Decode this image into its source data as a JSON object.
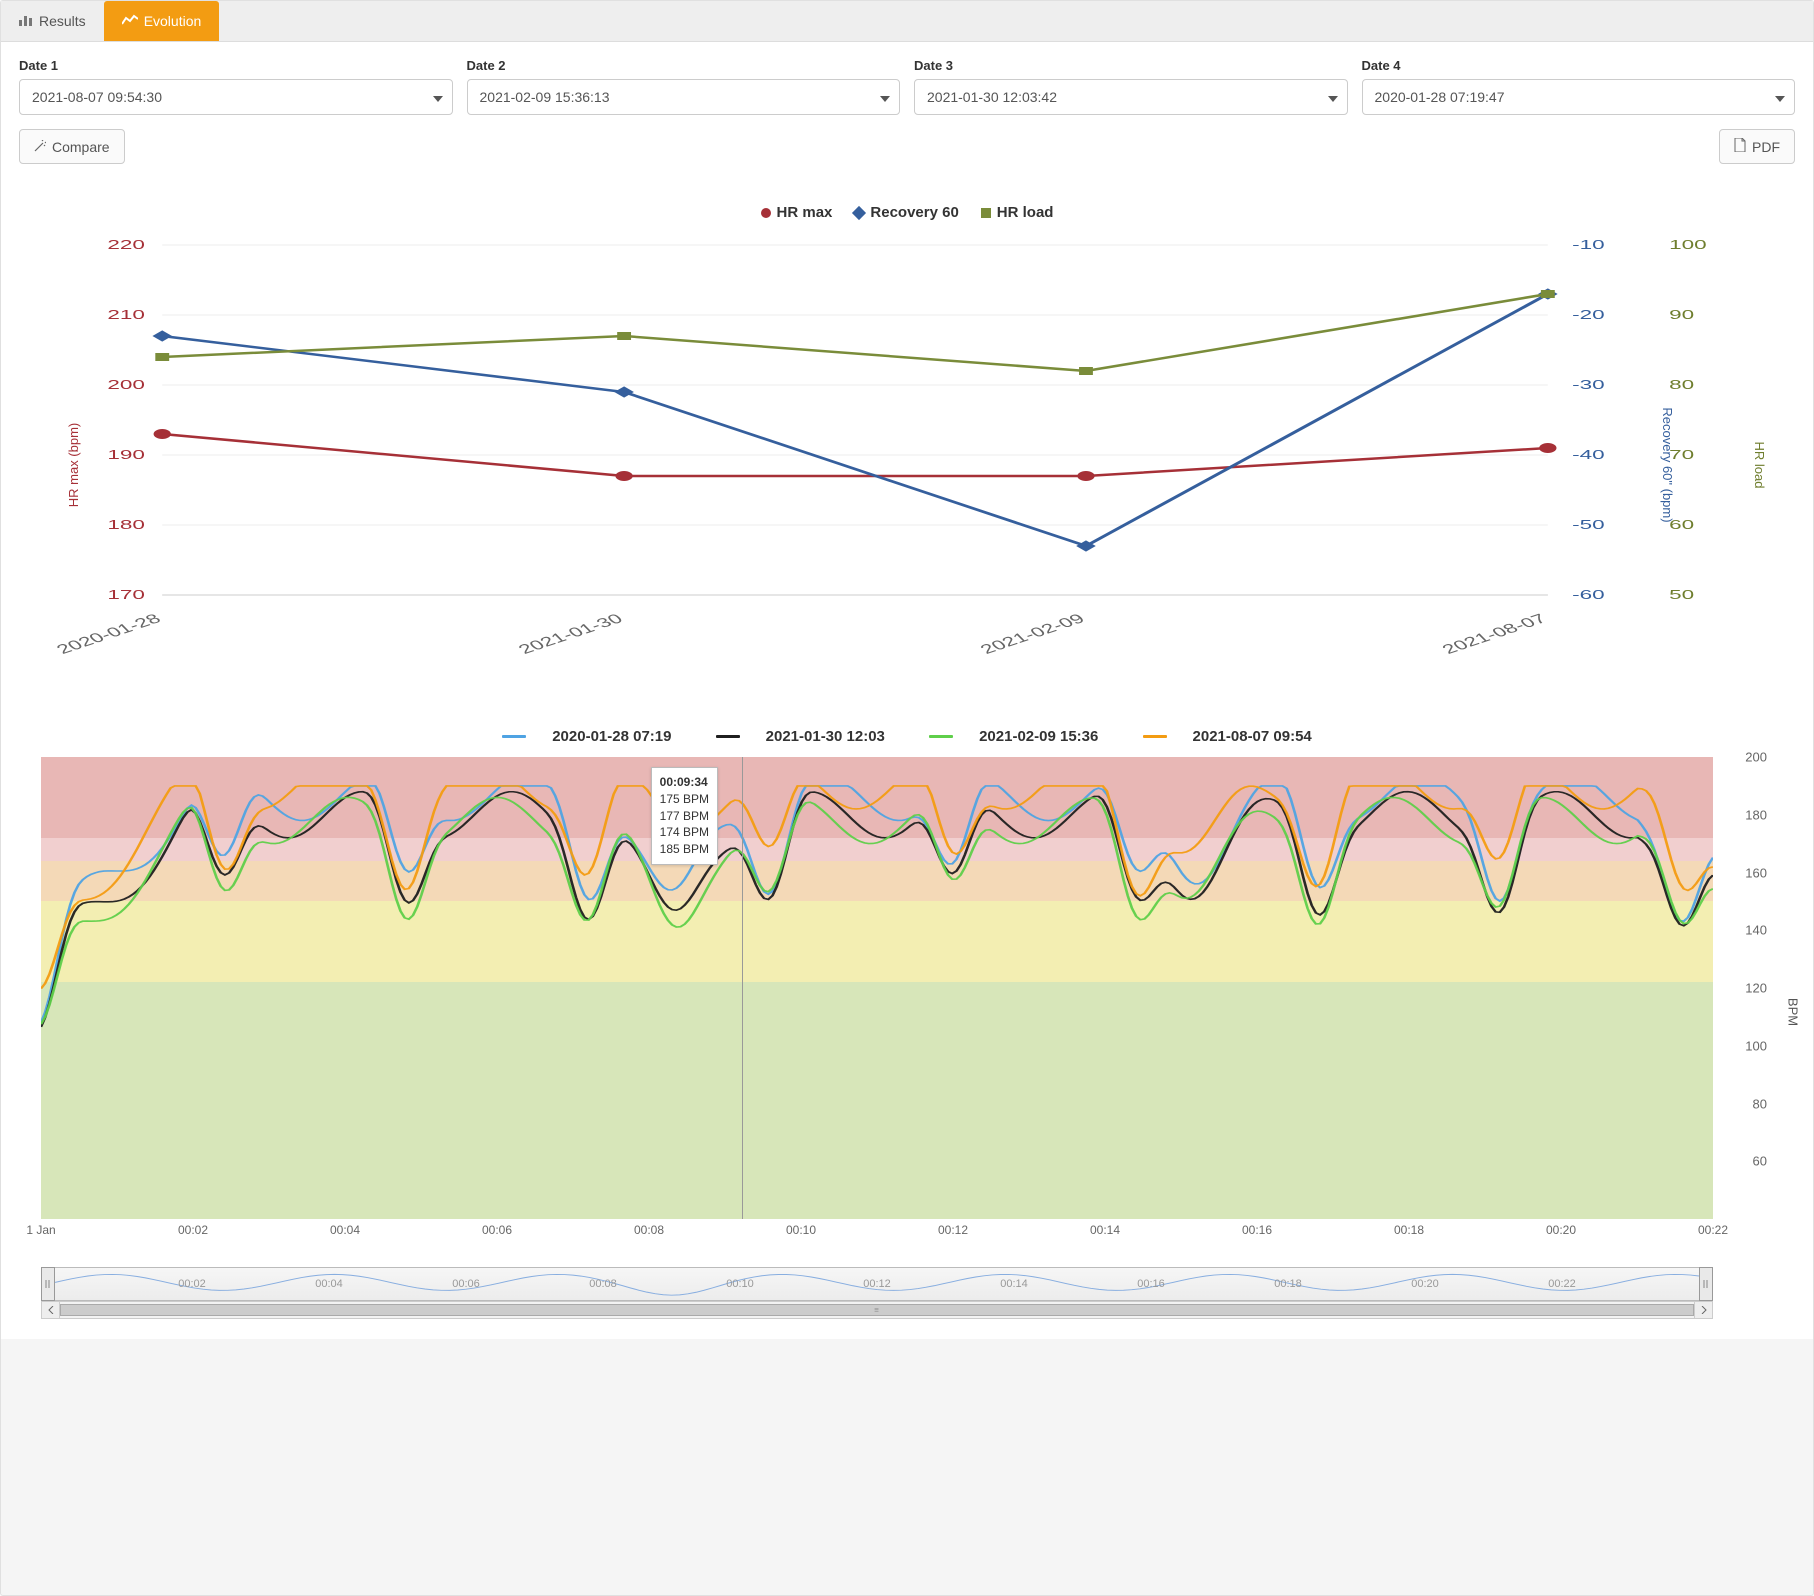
{
  "tabs": {
    "results": "Results",
    "evolution": "Evolution",
    "active": "evolution"
  },
  "date_labels": [
    "Date 1",
    "Date 2",
    "Date 3",
    "Date 4"
  ],
  "date_values": [
    "2021-08-07 09:54:30",
    "2021-02-09 15:36:13",
    "2021-01-30 12:03:42",
    "2020-01-28 07:19:47"
  ],
  "buttons": {
    "compare": "Compare",
    "pdf": "PDF"
  },
  "colors": {
    "hr_max": "#a63037",
    "recovery": "#355f9d",
    "hr_load": "#7a8c3a",
    "series1": "#4fa3e3",
    "series2": "#1f1f1f",
    "series3": "#5fcf4a",
    "series4": "#f39c12",
    "band_red": "#e8b7b5",
    "band_pink": "#f1cfcf",
    "band_orange": "#f4d9b7",
    "band_yellow": "#f3eeb2",
    "band_green": "#d7e6b9"
  },
  "chart_data": [
    {
      "type": "line",
      "title": "",
      "categories": [
        "2020-01-28",
        "2021-01-30",
        "2021-02-09",
        "2021-08-07"
      ],
      "series": [
        {
          "name": "HR max",
          "axis": "hr_max",
          "color": "#a63037",
          "marker": "dot",
          "values": [
            193,
            187,
            187,
            191
          ]
        },
        {
          "name": "Recovery 60",
          "axis": "recovery",
          "color": "#355f9d",
          "marker": "diamond",
          "values": [
            -23,
            -31,
            -53,
            -17
          ]
        },
        {
          "name": "HR load",
          "axis": "hr_load",
          "color": "#7a8c3a",
          "marker": "square",
          "values": [
            84,
            87,
            82,
            93
          ]
        }
      ],
      "axes": {
        "hr_max": {
          "label": "HR max (bpm)",
          "min": 170,
          "max": 220,
          "ticks": [
            170,
            180,
            190,
            200,
            210,
            220
          ],
          "color": "#a63037"
        },
        "recovery": {
          "label": "Recovery 60\" (bpm)",
          "min": -60,
          "max": -10,
          "ticks": [
            -60,
            -50,
            -40,
            -30,
            -20,
            -10
          ],
          "color": "#355f9d"
        },
        "hr_load": {
          "label": "HR load",
          "min": 50,
          "max": 100,
          "ticks": [
            50,
            60,
            70,
            80,
            90,
            100
          ],
          "color": "#6f7e2e"
        }
      }
    },
    {
      "type": "line",
      "ylabel": "BPM",
      "ylim": [
        40,
        200
      ],
      "yticks": [
        60,
        80,
        100,
        120,
        140,
        160,
        180,
        200
      ],
      "xlabel": "",
      "xticks": [
        "1 Jan",
        "00:02",
        "00:04",
        "00:06",
        "00:08",
        "00:10",
        "00:12",
        "00:14",
        "00:16",
        "00:18",
        "00:20",
        "00:22"
      ],
      "series_legend": [
        {
          "name": "2020-01-28 07:19",
          "color": "#4fa3e3"
        },
        {
          "name": "2021-01-30 12:03",
          "color": "#1f1f1f"
        },
        {
          "name": "2021-02-09 15:36",
          "color": "#5fcf4a"
        },
        {
          "name": "2021-08-07 09:54",
          "color": "#f39c12"
        }
      ],
      "bands": [
        {
          "from": 172,
          "to": 200,
          "color": "#e8b7b5"
        },
        {
          "from": 164,
          "to": 172,
          "color": "#f1cfcf"
        },
        {
          "from": 150,
          "to": 164,
          "color": "#f4d9b7"
        },
        {
          "from": 122,
          "to": 150,
          "color": "#f3eeb2"
        },
        {
          "from": 40,
          "to": 122,
          "color": "#d7e6b9"
        }
      ],
      "tooltip": {
        "time": "00:09:34",
        "rows": [
          "175 BPM",
          "177 BPM",
          "174 BPM",
          "185 BPM"
        ]
      },
      "brush_ticks": [
        "00:02",
        "00:04",
        "00:06",
        "00:08",
        "00:10",
        "00:12",
        "00:14",
        "00:16",
        "00:18",
        "00:20",
        "00:22"
      ]
    }
  ]
}
